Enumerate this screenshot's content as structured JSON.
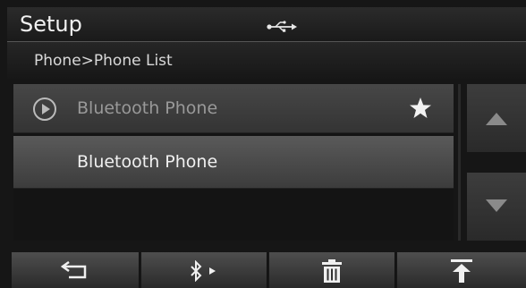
{
  "header": {
    "title": "Setup",
    "status_icon": "usb-icon"
  },
  "breadcrumb": {
    "text": "Phone>Phone List"
  },
  "phone_list": {
    "items": [
      {
        "label": "Bluetooth Phone",
        "icon": "play-circle-icon",
        "favorite": true,
        "state": "dimmed"
      },
      {
        "label": "Bluetooth Phone",
        "icon": "",
        "favorite": false,
        "state": "selected"
      }
    ]
  },
  "scroll": {
    "up_icon": "triangle-up-icon",
    "down_icon": "triangle-down-icon"
  },
  "toolbar": {
    "buttons": [
      "back-arrow-icon",
      "bluetooth-play-icon",
      "trash-icon",
      "scroll-to-top-icon"
    ]
  },
  "colors": {
    "text": "#f0f0f0",
    "dim_text": "#999999",
    "bg": "#161616"
  }
}
